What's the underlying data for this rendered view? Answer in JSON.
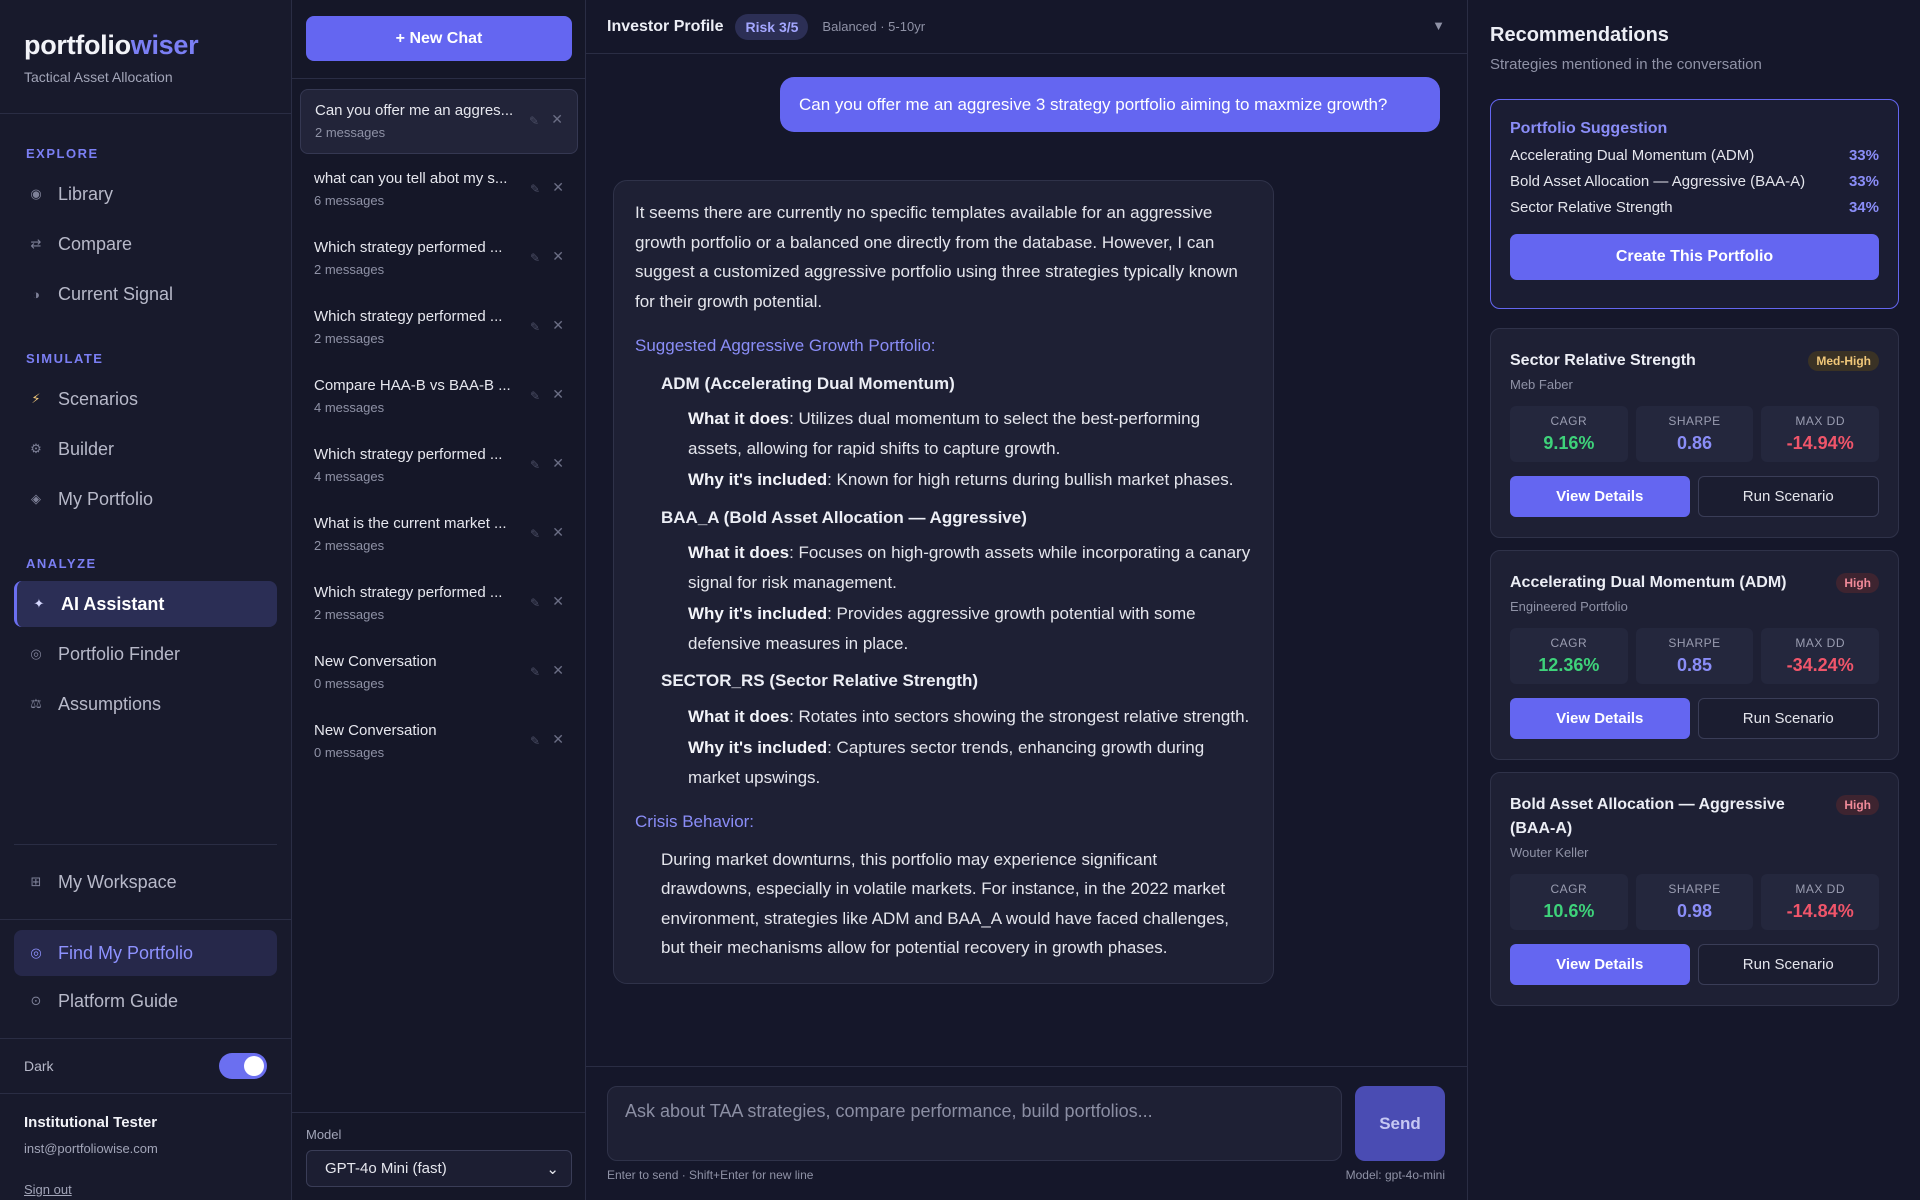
{
  "brand": {
    "name_a": "portfolio",
    "name_b": "wiser",
    "tagline": "Tactical Asset Allocation"
  },
  "nav": {
    "explore_label": "EXPLORE",
    "explore": [
      {
        "icon": "library-icon",
        "glyph": "◉",
        "label": "Library"
      },
      {
        "icon": "compare-icon",
        "glyph": "⇄",
        "label": "Compare"
      },
      {
        "icon": "signal-icon",
        "glyph": "◑",
        "label": "Current Signal"
      }
    ],
    "simulate_label": "SIMULATE",
    "simulate": [
      {
        "icon": "lightning-icon",
        "glyph": "⚡",
        "label": "Scenarios"
      },
      {
        "icon": "gear-icon",
        "glyph": "⚙",
        "label": "Builder"
      },
      {
        "icon": "diamond-icon",
        "glyph": "◈",
        "label": "My Portfolio"
      }
    ],
    "analyze_label": "ANALYZE",
    "analyze": [
      {
        "icon": "sparkle-icon",
        "glyph": "✦",
        "label": "AI Assistant",
        "active": true
      },
      {
        "icon": "target-icon",
        "glyph": "◎",
        "label": "Portfolio Finder"
      },
      {
        "icon": "scale-icon",
        "glyph": "⚖",
        "label": "Assumptions"
      }
    ],
    "workspace": {
      "icon": "grid-icon",
      "glyph": "⊞",
      "label": "My Workspace"
    },
    "find": {
      "icon": "target-icon",
      "glyph": "◎",
      "label": "Find My Portfolio"
    },
    "guide": {
      "icon": "compass-icon",
      "glyph": "⊙",
      "label": "Platform Guide"
    }
  },
  "theme": {
    "label": "Dark",
    "on": true
  },
  "user": {
    "name": "Institutional Tester",
    "email": "inst@portfoliowise.com",
    "sign_out": "Sign out"
  },
  "chatlist": {
    "new_chat": "+ New Chat",
    "conversations": [
      {
        "title": "Can you offer me an aggres...",
        "count": "2 messages",
        "active": true
      },
      {
        "title": "what can you tell abot my s...",
        "count": "6 messages"
      },
      {
        "title": "Which strategy performed ...",
        "count": "2 messages"
      },
      {
        "title": "Which strategy performed ...",
        "count": "2 messages"
      },
      {
        "title": "Compare HAA-B vs BAA-B ...",
        "count": "4 messages"
      },
      {
        "title": "Which strategy performed ...",
        "count": "4 messages"
      },
      {
        "title": "What is the current market ...",
        "count": "2 messages"
      },
      {
        "title": "Which strategy performed ...",
        "count": "2 messages"
      },
      {
        "title": "New Conversation",
        "count": "0 messages"
      },
      {
        "title": "New Conversation",
        "count": "0 messages"
      }
    ],
    "model_label": "Model",
    "model_value": "GPT-4o Mini (fast)"
  },
  "profile": {
    "title": "Investor Profile",
    "risk": "Risk 3/5",
    "summary": "Balanced · 5-10yr"
  },
  "chat": {
    "user_message": "Can you offer me an aggresive 3 strategy portfolio aiming to maxmize growth?",
    "ai": {
      "intro": "It seems there are currently no specific templates available for an aggressive growth portfolio or a balanced one directly from the database. However, I can suggest a customized aggressive portfolio using three strategies typically known for their growth potential.",
      "heading": "Suggested Aggressive Growth Portfolio:",
      "what_label": "What it does",
      "why_label": "Why it's included",
      "strategies": [
        {
          "name": "ADM (Accelerating Dual Momentum)",
          "what": ": Utilizes dual momentum to select the best-performing assets, allowing for rapid shifts to capture growth.",
          "why": ": Known for high returns during bullish market phases."
        },
        {
          "name": "BAA_A (Bold Asset Allocation — Aggressive)",
          "what": ": Focuses on high-growth assets while incorporating a canary signal for risk management.",
          "why": ": Provides aggressive growth potential with some defensive measures in place."
        },
        {
          "name": "SECTOR_RS (Sector Relative Strength)",
          "what": ": Rotates into sectors showing the strongest relative strength.",
          "why": ": Captures sector trends, enhancing growth during market upswings."
        }
      ],
      "crisis_heading": "Crisis Behavior:",
      "crisis_text": "During market downturns, this portfolio may experience significant drawdowns, especially in volatile markets. For instance, in the 2022 market environment, strategies like ADM and BAA_A would have faced challenges, but their mechanisms allow for potential recovery in growth phases."
    },
    "input_placeholder": "Ask about TAA strategies, compare performance, build portfolios...",
    "send": "Send",
    "hint": "Enter to send · Shift+Enter for new line",
    "model_hint": "Model: gpt-4o-mini"
  },
  "recs": {
    "title": "Recommendations",
    "subtitle": "Strategies mentioned in the conversation",
    "suggestion": {
      "title": "Portfolio Suggestion",
      "allocations": [
        {
          "name": "Accelerating Dual Momentum (ADM)",
          "pct": "33%"
        },
        {
          "name": "Bold Asset Allocation — Aggressive (BAA-A)",
          "pct": "33%"
        },
        {
          "name": "Sector Relative Strength",
          "pct": "34%"
        }
      ],
      "create": "Create This Portfolio"
    },
    "metric_labels": {
      "cagr": "CAGR",
      "sharpe": "SHARPE",
      "maxdd": "MAX DD"
    },
    "view": "View Details",
    "run": "Run Scenario",
    "cards": [
      {
        "name": "Sector Relative Strength",
        "author": "Meb Faber",
        "risk": "Med-High",
        "cagr": "9.16%",
        "sharpe": "0.86",
        "maxdd": "-14.94%"
      },
      {
        "name": "Accelerating Dual Momentum (ADM)",
        "author": "Engineered Portfolio",
        "risk": "High",
        "cagr": "12.36%",
        "sharpe": "0.85",
        "maxdd": "-34.24%"
      },
      {
        "name": "Bold Asset Allocation — Aggressive (BAA-A)",
        "author": "Wouter Keller",
        "risk": "High",
        "cagr": "10.6%",
        "sharpe": "0.98",
        "maxdd": "-14.84%"
      }
    ]
  },
  "colors": {
    "accent": "#6466f1",
    "positive": "#3ed27a",
    "negative": "#f0556a",
    "background": "#111322"
  }
}
